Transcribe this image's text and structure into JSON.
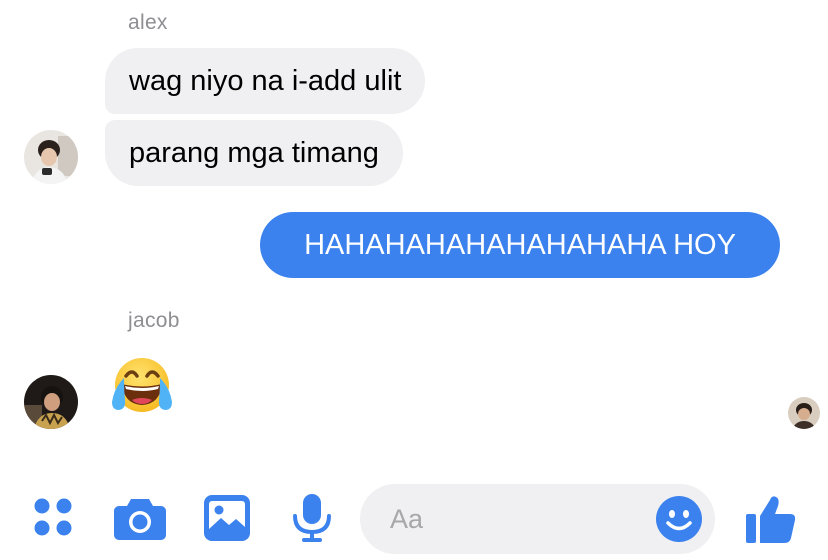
{
  "conversation": {
    "groups": [
      {
        "sender": "alex",
        "messages": [
          "wag niyo na i-add ulit",
          "parang mga timang"
        ]
      },
      {
        "sender": "jacob",
        "messages": [
          "😂"
        ]
      }
    ],
    "outgoing": [
      "HAHAHAHAHAHAHAHAHA HOY"
    ],
    "emoji_name": "face-with-tears-of-joy"
  },
  "composer": {
    "placeholder": "Aa",
    "icons": [
      "more-apps-icon",
      "camera-icon",
      "gallery-icon",
      "microphone-icon",
      "emoji-icon",
      "thumbs-up-icon"
    ],
    "accent_color": "#3b82ee"
  },
  "colors": {
    "incoming_bubble": "#f0f0f2",
    "outgoing_bubble": "#3b82ee",
    "sender_name": "#8e8e93"
  }
}
